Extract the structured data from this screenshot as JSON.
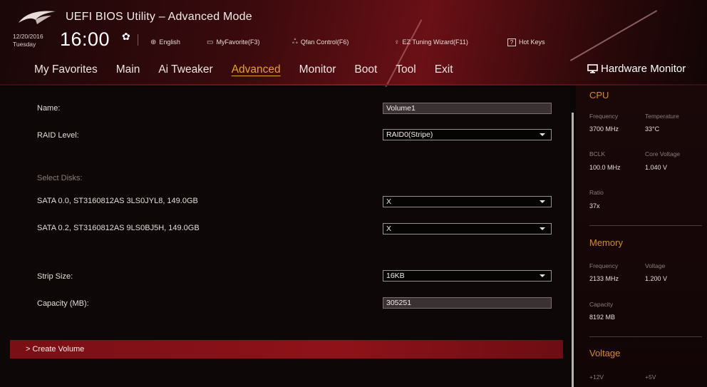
{
  "header": {
    "app_title": "UEFI BIOS Utility – Advanced Mode",
    "date": "12/20/2016",
    "weekday": "Tuesday",
    "time": "16:00",
    "toolbar": {
      "language": "English",
      "my_favorite": "MyFavorite(F3)",
      "qfan": "Qfan Control(F6)",
      "ez_tuning": "EZ Tuning Wizard(F11)",
      "hot_keys": "Hot Keys",
      "hot_keys_box": "?"
    },
    "icons": [
      "rog-logo",
      "gear-icon",
      "globe-icon",
      "favorites-icon",
      "fan-icon",
      "bulb-icon",
      "help-icon"
    ]
  },
  "nav": {
    "items": [
      {
        "label": "My Favorites"
      },
      {
        "label": "Main"
      },
      {
        "label": "Ai Tweaker"
      },
      {
        "label": "Advanced"
      },
      {
        "label": "Monitor"
      },
      {
        "label": "Boot"
      },
      {
        "label": "Tool"
      },
      {
        "label": "Exit"
      }
    ],
    "active": "Advanced"
  },
  "form": {
    "name_label": "Name:",
    "name_value": "Volume1",
    "raid_label": "RAID Level:",
    "raid_value": "RAID0(Stripe)",
    "select_disks_label": "Select Disks:",
    "disk1_label": "SATA 0.0, ST3160812AS 3LS0JYL8, 149.0GB",
    "disk1_value": "X",
    "disk2_label": "SATA 0.2, ST3160812AS 9LS0BJ5H, 149.0GB",
    "disk2_value": "X",
    "strip_label": "Strip Size:",
    "strip_value": "16KB",
    "capacity_label": "Capacity (MB):",
    "capacity_value": "305251",
    "create_volume": "> Create Volume"
  },
  "hardware_monitor": {
    "title": "Hardware Monitor",
    "cpu": {
      "heading": "CPU",
      "frequency_label": "Frequency",
      "frequency": "3700 MHz",
      "temperature_label": "Temperature",
      "temperature": "33°C",
      "bclk_label": "BCLK",
      "bclk": "100.0 MHz",
      "core_voltage_label": "Core Voltage",
      "core_voltage": "1.040 V",
      "ratio_label": "Ratio",
      "ratio": "37x"
    },
    "memory": {
      "heading": "Memory",
      "frequency_label": "Frequency",
      "frequency": "2133 MHz",
      "voltage_label": "Voltage",
      "voltage": "1.200 V",
      "capacity_label": "Capacity",
      "capacity": "8192 MB"
    },
    "voltage": {
      "heading": "Voltage",
      "v12_label": "+12V",
      "v5_label": "+5V"
    }
  },
  "colors": {
    "accent_orange": "#e8a31c",
    "header_red": "#6a1016",
    "create_bar": "#8f1219",
    "section_orange": "#d98a1c"
  }
}
